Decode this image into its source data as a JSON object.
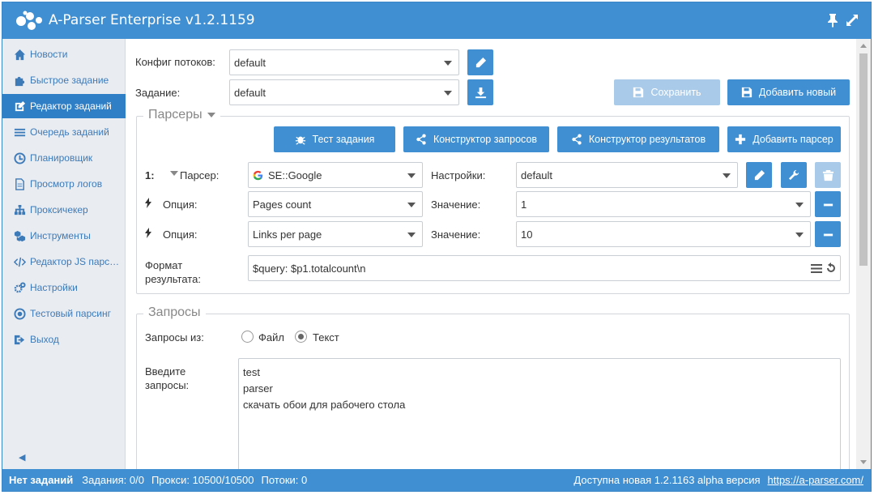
{
  "app": {
    "title": "A-Parser Enterprise v1.2.1159"
  },
  "sidebar": {
    "items": [
      {
        "label": "Новости",
        "icon": "home-icon"
      },
      {
        "label": "Быстрое задание",
        "icon": "puzzle-icon"
      },
      {
        "label": "Редактор заданий",
        "icon": "edit-icon",
        "active": true
      },
      {
        "label": "Очередь заданий",
        "icon": "list-icon"
      },
      {
        "label": "Планировщик",
        "icon": "clock-icon"
      },
      {
        "label": "Просмотр логов",
        "icon": "file-icon"
      },
      {
        "label": "Проксичекер",
        "icon": "sitemap-icon"
      },
      {
        "label": "Инструменты",
        "icon": "cubes-icon"
      },
      {
        "label": "Редактор JS парс…",
        "icon": "code-icon"
      },
      {
        "label": "Настройки",
        "icon": "cogs-icon"
      },
      {
        "label": "Тестовый парсинг",
        "icon": "target-icon"
      },
      {
        "label": "Выход",
        "icon": "signout-icon"
      }
    ],
    "collapse": "◀"
  },
  "task": {
    "threads_label": "Конфиг потоков:",
    "threads_value": "default",
    "task_label": "Задание:",
    "task_value": "default",
    "save_label": "Сохранить",
    "add_new_label": "Добавить новый"
  },
  "parsers": {
    "legend": "Парсеры",
    "test_btn": "Тест задания",
    "query_builder_btn": "Конструктор запросов",
    "result_builder_btn": "Конструктор результатов",
    "add_parser_btn": "Добавить парсер",
    "index": "1:",
    "parser_label": "Парсер:",
    "parser_value": "SE::Google",
    "settings_label": "Настройки:",
    "settings_value": "default",
    "options": [
      {
        "label": "Опция:",
        "name": "Pages count",
        "value_label": "Значение:",
        "value": "1"
      },
      {
        "label": "Опция:",
        "name": "Links per page",
        "value_label": "Значение:",
        "value": "10"
      }
    ],
    "format_label": "Формат результата:",
    "format_value": "$query: $p1.totalcount\\n"
  },
  "queries": {
    "legend": "Запросы",
    "from_label": "Запросы из:",
    "file_label": "Файл",
    "text_label": "Текст",
    "input_label": "Введите запросы:",
    "lines": [
      "test",
      "parser",
      "скачать обои для рабочего стола"
    ]
  },
  "status": {
    "no_tasks": "Нет заданий",
    "tasks": "Задания: 0/0",
    "proxies": "Прокси: 10500/10500",
    "threads": "Потоки: 0",
    "update_text": "Доступна новая 1.2.1163 alpha версия",
    "update_link": "https://a-parser.com/"
  },
  "colors": {
    "accent": "#3f8fd2",
    "accent_disabled": "#a9cbe9",
    "sidebar_bg": "#e9ecf1",
    "link": "#3d7ab8"
  }
}
